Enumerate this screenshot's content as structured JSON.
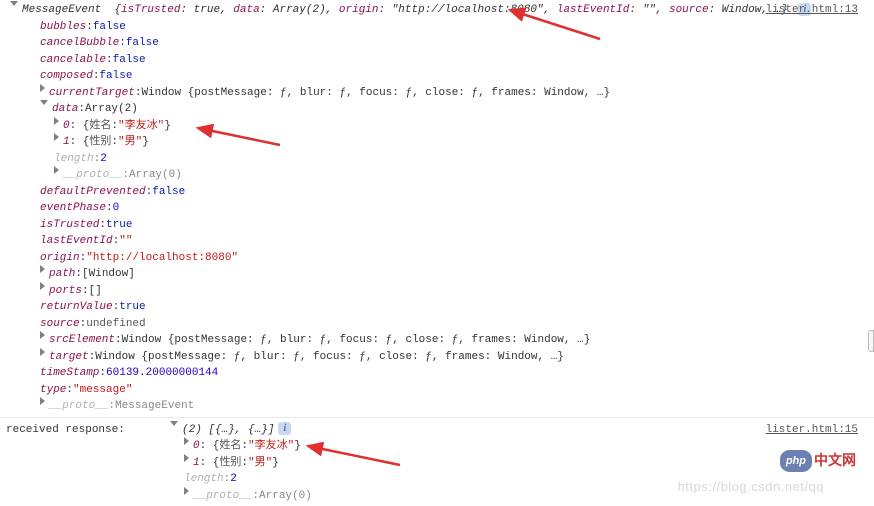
{
  "source1": "lister.html:13",
  "source2": "lister.html:15",
  "header": {
    "class": "MessageEvent",
    "open": "{",
    "close": "}",
    "previewPairs": [
      {
        "k": "isTrusted",
        "v": "true",
        "vtype": "bool"
      },
      {
        "k": "data",
        "v": "Array(2)",
        "vtype": "obj"
      },
      {
        "k": "origin",
        "v": "\"http://localhost:8080\"",
        "vtype": "str"
      },
      {
        "k": "lastEventId",
        "v": "\"\"",
        "vtype": "str"
      },
      {
        "k": "source",
        "v": "Window",
        "vtype": "obj"
      },
      {
        "k": "…",
        "v": "",
        "vtype": "ell"
      }
    ]
  },
  "props": {
    "bubbles": {
      "k": "bubbles",
      "v": "false",
      "vtype": "bool",
      "indent": 1
    },
    "cancelBubble": {
      "k": "cancelBubble",
      "v": "false",
      "vtype": "bool",
      "indent": 1
    },
    "cancelable": {
      "k": "cancelable",
      "v": "false",
      "vtype": "bool",
      "indent": 1
    },
    "composed": {
      "k": "composed",
      "v": "false",
      "vtype": "bool",
      "indent": 1
    },
    "currentTarget": {
      "k": "currentTarget",
      "v": "Window {postMessage: ƒ, blur: ƒ, focus: ƒ, close: ƒ, frames: Window, …}",
      "vtype": "obj",
      "indent": 1,
      "tri": "close"
    },
    "dataLabel": {
      "k": "data",
      "v": "Array(2)",
      "indent": 1
    },
    "data0": {
      "k": "0",
      "v": "{姓名: \"李友冰\"}",
      "indent": 2,
      "inner": {
        "key": "姓名",
        "val": "\"李友冰\""
      }
    },
    "data1": {
      "k": "1",
      "v": "{性别: \"男\"}",
      "indent": 2,
      "inner": {
        "key": "性别",
        "val": "\"男\""
      }
    },
    "length": {
      "k": "length",
      "v": "2",
      "vtype": "num",
      "indent": 2
    },
    "arrProto": {
      "k": "__proto__",
      "v": "Array(0)",
      "indent": 2
    },
    "defaultPrevented": {
      "k": "defaultPrevented",
      "v": "false",
      "vtype": "bool",
      "indent": 1
    },
    "eventPhase": {
      "k": "eventPhase",
      "v": "0",
      "vtype": "num",
      "indent": 1
    },
    "isTrusted": {
      "k": "isTrusted",
      "v": "true",
      "vtype": "bool",
      "indent": 1
    },
    "lastEventId": {
      "k": "lastEventId",
      "v": "\"\"",
      "vtype": "str",
      "indent": 1
    },
    "origin": {
      "k": "origin",
      "v": "\"http://localhost:8080\"",
      "vtype": "str",
      "indent": 1
    },
    "path": {
      "k": "path",
      "v": "[Window]",
      "vtype": "obj",
      "indent": 1,
      "tri": "close"
    },
    "ports": {
      "k": "ports",
      "v": "[]",
      "vtype": "obj",
      "indent": 1,
      "tri": "close"
    },
    "returnValue": {
      "k": "returnValue",
      "v": "true",
      "vtype": "bool",
      "indent": 1
    },
    "sourceW": {
      "k": "source",
      "v": "undefined",
      "vtype": "kw",
      "indent": 1
    },
    "srcElement": {
      "k": "srcElement",
      "v": "Window {postMessage: ƒ, blur: ƒ, focus: ƒ, close: ƒ, frames: Window, …}",
      "vtype": "obj",
      "indent": 1,
      "tri": "close"
    },
    "target": {
      "k": "target",
      "v": "Window {postMessage: ƒ, blur: ƒ, focus: ƒ, close: ƒ, frames: Window, …}",
      "vtype": "obj",
      "indent": 1,
      "tri": "close"
    },
    "timeStamp": {
      "k": "timeStamp",
      "v": "60139.20000000144",
      "vtype": "num",
      "indent": 1
    },
    "type": {
      "k": "type",
      "v": "\"message\"",
      "vtype": "str",
      "indent": 1
    },
    "proto": {
      "k": "__proto__",
      "v": "MessageEvent",
      "vtype": "obj",
      "indent": 1,
      "tri": "close"
    }
  },
  "second": {
    "label": "received response:  ",
    "preview": "(2) [{…}, {…}]",
    "data0": {
      "k": "0",
      "inner": {
        "key": "姓名",
        "val": "\"李友冰\""
      }
    },
    "data1": {
      "k": "1",
      "inner": {
        "key": "性别",
        "val": "\"男\""
      }
    },
    "length": {
      "k": "length",
      "v": "2"
    },
    "proto": {
      "k": "__proto__",
      "v": "Array(0)"
    }
  },
  "watermark": "https://blog.csdn.net/qq",
  "badge": {
    "logo": "php",
    "text": "中文网"
  }
}
